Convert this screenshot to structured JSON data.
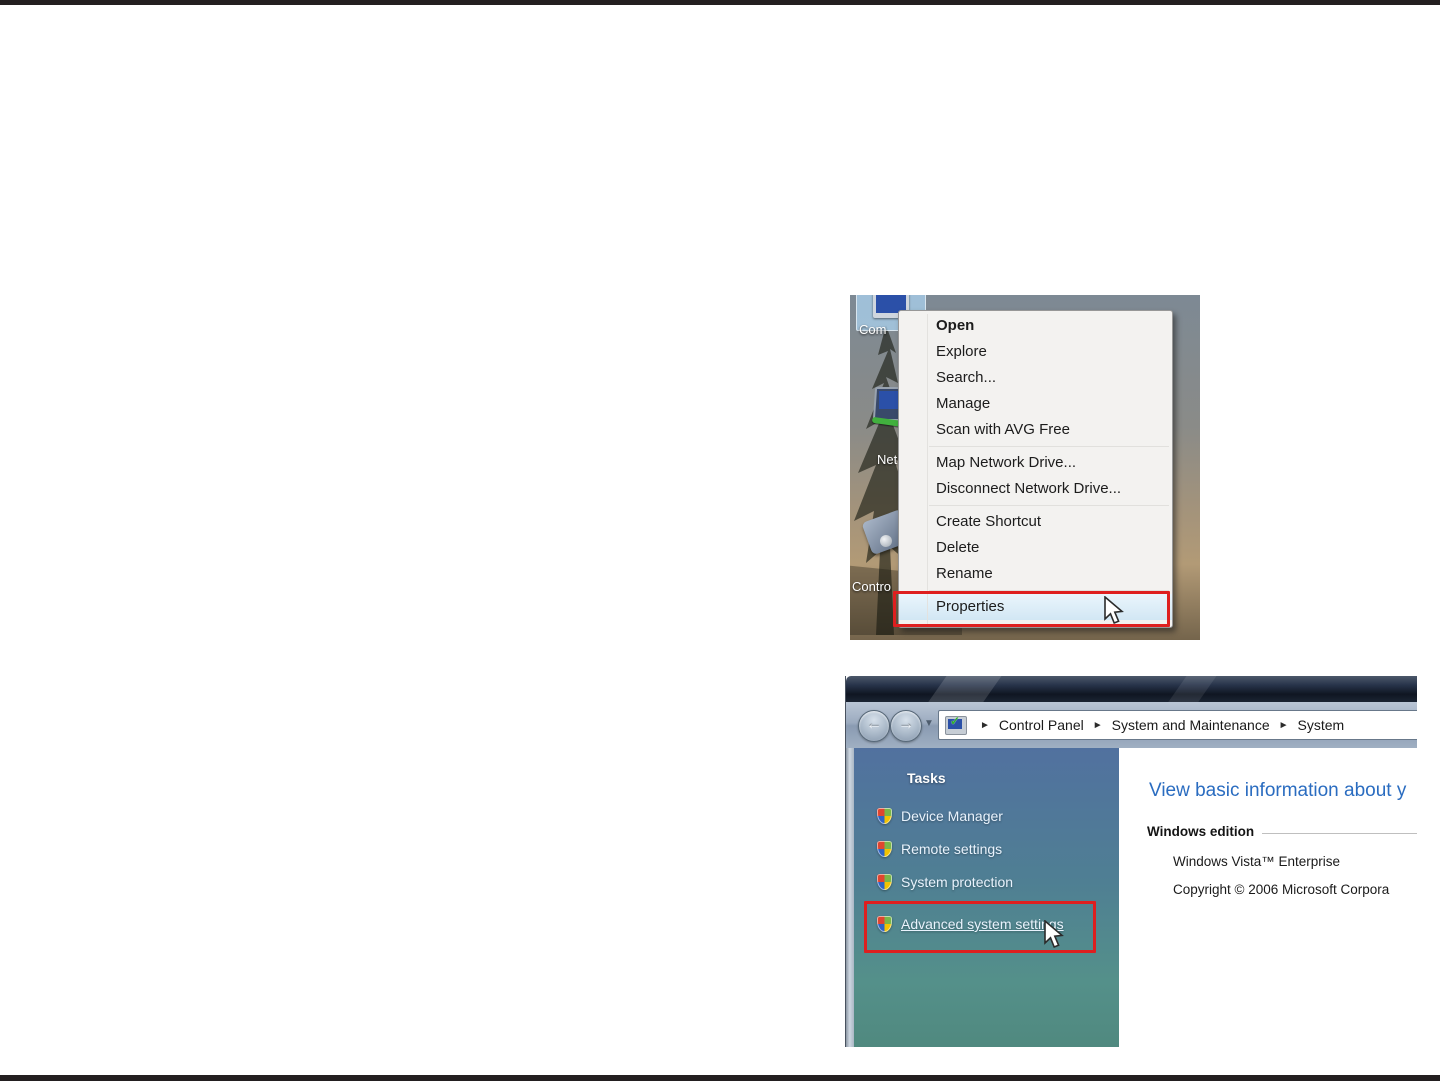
{
  "icons": {
    "back_arrow": "←",
    "forward_arrow": "→",
    "dropdown_chevron": "▼",
    "breadcrumb_arrow": "►",
    "check_mark": "✓"
  },
  "colors": {
    "annotation_red": "#de1f1f",
    "heading_blue": "#2a6cc0",
    "sidebar_top_blue": "#51719f",
    "sidebar_bottom_teal": "#50897f",
    "menu_highlight_blue": "#d2e7f4",
    "page_frame_black": "#231f20"
  },
  "shot1": {
    "desktop_icons": {
      "computer": "Com",
      "network": "Net",
      "control_panel": "Contro"
    },
    "menu_items": [
      "Open",
      "Explore",
      "Search...",
      "Manage",
      "Scan with AVG Free",
      "Map Network Drive...",
      "Disconnect Network Drive...",
      "Create Shortcut",
      "Delete",
      "Rename",
      "Properties"
    ]
  },
  "shot2": {
    "breadcrumb": [
      "Control Panel",
      "System and Maintenance",
      "System"
    ],
    "sidebar": {
      "title": "Tasks",
      "items": [
        "Device Manager",
        "Remote settings",
        "System protection",
        "Advanced system settings"
      ]
    },
    "content": {
      "heading": "View basic information about y",
      "section": "Windows edition",
      "edition": "Windows Vista™ Enterprise",
      "copyright": "Copyright © 2006 Microsoft Corpora"
    }
  }
}
